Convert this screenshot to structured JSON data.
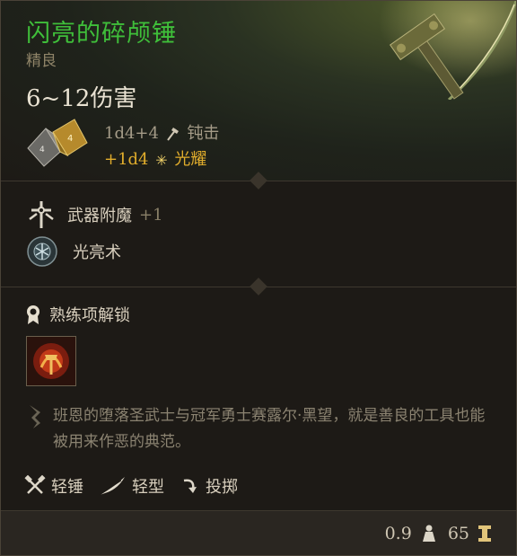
{
  "item": {
    "name": "闪亮的碎颅锤",
    "rarity": "精良",
    "damage_range": "6~12伤害"
  },
  "damage": {
    "base": "1d4+4",
    "base_type": "钝击",
    "bonus": "+1d4",
    "bonus_type": "光耀"
  },
  "enchant": {
    "label": "武器附魔",
    "bonus": "+1",
    "spell": "光亮术"
  },
  "proficiency": {
    "label": "熟练项解锁"
  },
  "lore": "班恩的堕落圣武士与冠军勇士赛露尔·黑望，就是善良的工具也能被用来作恶的典范。",
  "properties": [
    {
      "label": "轻锤",
      "icon": "crossed-hammers-icon"
    },
    {
      "label": "轻型",
      "icon": "feather-icon"
    },
    {
      "label": "投掷",
      "icon": "throw-icon"
    }
  ],
  "footer": {
    "weight": "0.9",
    "price": "65"
  },
  "colors": {
    "title": "#3fbf3a",
    "radiant": "#e1ad2c",
    "muted": "#8f8468"
  }
}
